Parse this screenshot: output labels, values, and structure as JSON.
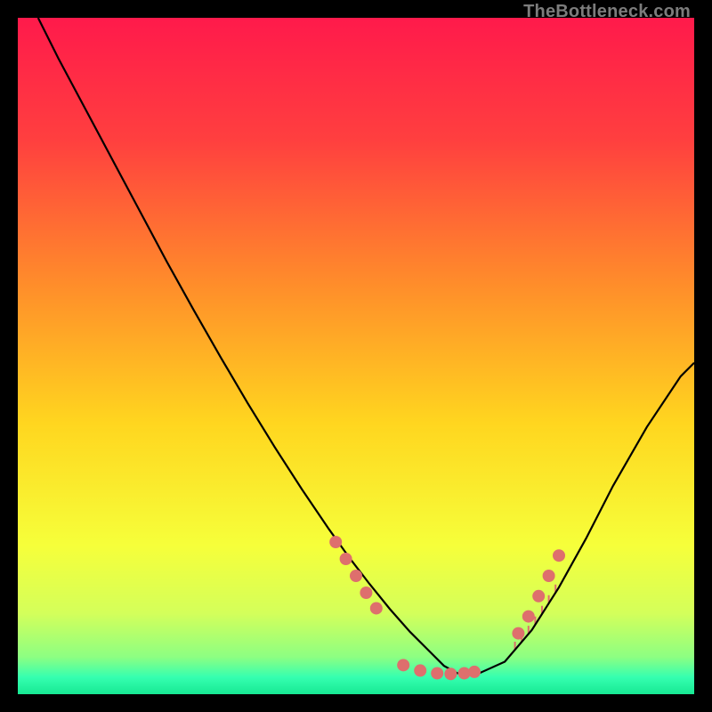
{
  "watermark": "TheBottleneck.com",
  "chart_data": {
    "type": "line",
    "title": "",
    "xlabel": "",
    "ylabel": "",
    "xlim": [
      0,
      100
    ],
    "ylim": [
      0,
      100
    ],
    "gradient_stops": [
      {
        "offset": 0.0,
        "color": "#ff1a4b"
      },
      {
        "offset": 0.18,
        "color": "#ff3f3f"
      },
      {
        "offset": 0.4,
        "color": "#ff8f2a"
      },
      {
        "offset": 0.6,
        "color": "#ffd61f"
      },
      {
        "offset": 0.78,
        "color": "#f6ff3a"
      },
      {
        "offset": 0.88,
        "color": "#d4ff5a"
      },
      {
        "offset": 0.945,
        "color": "#8dff82"
      },
      {
        "offset": 0.975,
        "color": "#35ffb0"
      },
      {
        "offset": 1.0,
        "color": "#17e893"
      }
    ],
    "series": [
      {
        "name": "curve",
        "color": "#000000",
        "x": [
          3,
          6,
          10,
          14,
          18,
          22,
          26,
          30,
          34,
          38,
          42,
          46,
          49,
          52,
          55,
          58,
          61,
          63,
          65,
          68,
          72,
          76,
          80,
          84,
          88,
          93,
          98,
          100
        ],
        "y": [
          100,
          94,
          86.5,
          79,
          71.5,
          64,
          56.8,
          49.8,
          43,
          36.5,
          30.3,
          24.4,
          20.2,
          16.3,
          12.6,
          9.2,
          6.2,
          4.2,
          3.1,
          3.0,
          4.8,
          9.5,
          15.8,
          23.0,
          30.8,
          39.5,
          47.0,
          49.0
        ]
      }
    ],
    "dots": {
      "color": "#de6f6d",
      "radius_px": 7,
      "points": [
        {
          "x": 47.0,
          "y": 22.5
        },
        {
          "x": 48.5,
          "y": 20.0
        },
        {
          "x": 50.0,
          "y": 17.5
        },
        {
          "x": 51.5,
          "y": 15.0
        },
        {
          "x": 53.0,
          "y": 12.7
        },
        {
          "x": 57.0,
          "y": 4.3
        },
        {
          "x": 59.5,
          "y": 3.5
        },
        {
          "x": 62.0,
          "y": 3.1
        },
        {
          "x": 64.0,
          "y": 3.0
        },
        {
          "x": 66.0,
          "y": 3.1
        },
        {
          "x": 67.5,
          "y": 3.3
        },
        {
          "x": 74.0,
          "y": 9.0
        },
        {
          "x": 75.5,
          "y": 11.5
        },
        {
          "x": 77.0,
          "y": 14.5
        },
        {
          "x": 78.5,
          "y": 17.5
        },
        {
          "x": 80.0,
          "y": 20.5
        }
      ]
    },
    "ticks": {
      "color": "#dc6e6c",
      "height_frac": 0.012,
      "x": [
        73.5,
        74.5,
        75.5,
        76.5,
        77.5,
        78.5,
        79.5
      ]
    }
  }
}
